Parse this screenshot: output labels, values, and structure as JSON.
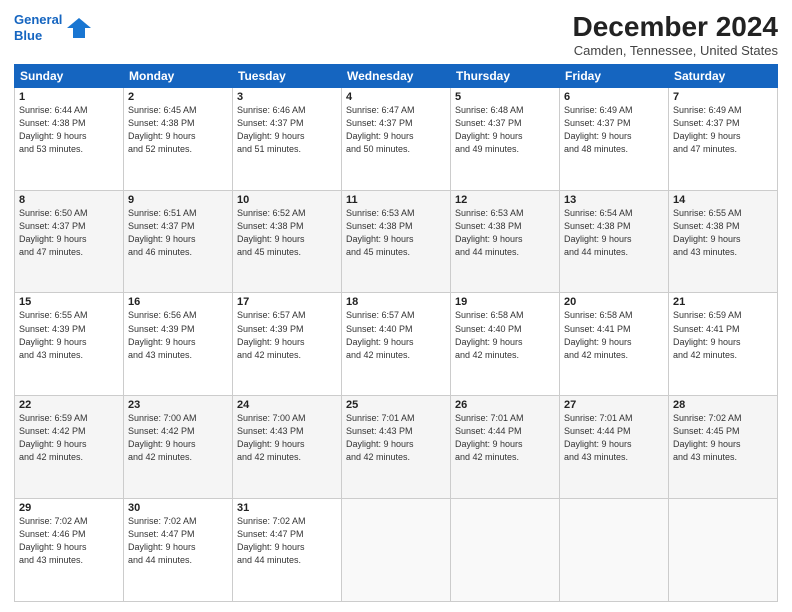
{
  "logo": {
    "line1": "General",
    "line2": "Blue",
    "arrow_color": "#1976d2"
  },
  "title": "December 2024",
  "subtitle": "Camden, Tennessee, United States",
  "days_of_week": [
    "Sunday",
    "Monday",
    "Tuesday",
    "Wednesday",
    "Thursday",
    "Friday",
    "Saturday"
  ],
  "weeks": [
    [
      {
        "day": "1",
        "info": "Sunrise: 6:44 AM\nSunset: 4:38 PM\nDaylight: 9 hours\nand 53 minutes."
      },
      {
        "day": "2",
        "info": "Sunrise: 6:45 AM\nSunset: 4:38 PM\nDaylight: 9 hours\nand 52 minutes."
      },
      {
        "day": "3",
        "info": "Sunrise: 6:46 AM\nSunset: 4:37 PM\nDaylight: 9 hours\nand 51 minutes."
      },
      {
        "day": "4",
        "info": "Sunrise: 6:47 AM\nSunset: 4:37 PM\nDaylight: 9 hours\nand 50 minutes."
      },
      {
        "day": "5",
        "info": "Sunrise: 6:48 AM\nSunset: 4:37 PM\nDaylight: 9 hours\nand 49 minutes."
      },
      {
        "day": "6",
        "info": "Sunrise: 6:49 AM\nSunset: 4:37 PM\nDaylight: 9 hours\nand 48 minutes."
      },
      {
        "day": "7",
        "info": "Sunrise: 6:49 AM\nSunset: 4:37 PM\nDaylight: 9 hours\nand 47 minutes."
      }
    ],
    [
      {
        "day": "8",
        "info": "Sunrise: 6:50 AM\nSunset: 4:37 PM\nDaylight: 9 hours\nand 47 minutes."
      },
      {
        "day": "9",
        "info": "Sunrise: 6:51 AM\nSunset: 4:37 PM\nDaylight: 9 hours\nand 46 minutes."
      },
      {
        "day": "10",
        "info": "Sunrise: 6:52 AM\nSunset: 4:38 PM\nDaylight: 9 hours\nand 45 minutes."
      },
      {
        "day": "11",
        "info": "Sunrise: 6:53 AM\nSunset: 4:38 PM\nDaylight: 9 hours\nand 45 minutes."
      },
      {
        "day": "12",
        "info": "Sunrise: 6:53 AM\nSunset: 4:38 PM\nDaylight: 9 hours\nand 44 minutes."
      },
      {
        "day": "13",
        "info": "Sunrise: 6:54 AM\nSunset: 4:38 PM\nDaylight: 9 hours\nand 44 minutes."
      },
      {
        "day": "14",
        "info": "Sunrise: 6:55 AM\nSunset: 4:38 PM\nDaylight: 9 hours\nand 43 minutes."
      }
    ],
    [
      {
        "day": "15",
        "info": "Sunrise: 6:55 AM\nSunset: 4:39 PM\nDaylight: 9 hours\nand 43 minutes."
      },
      {
        "day": "16",
        "info": "Sunrise: 6:56 AM\nSunset: 4:39 PM\nDaylight: 9 hours\nand 43 minutes."
      },
      {
        "day": "17",
        "info": "Sunrise: 6:57 AM\nSunset: 4:39 PM\nDaylight: 9 hours\nand 42 minutes."
      },
      {
        "day": "18",
        "info": "Sunrise: 6:57 AM\nSunset: 4:40 PM\nDaylight: 9 hours\nand 42 minutes."
      },
      {
        "day": "19",
        "info": "Sunrise: 6:58 AM\nSunset: 4:40 PM\nDaylight: 9 hours\nand 42 minutes."
      },
      {
        "day": "20",
        "info": "Sunrise: 6:58 AM\nSunset: 4:41 PM\nDaylight: 9 hours\nand 42 minutes."
      },
      {
        "day": "21",
        "info": "Sunrise: 6:59 AM\nSunset: 4:41 PM\nDaylight: 9 hours\nand 42 minutes."
      }
    ],
    [
      {
        "day": "22",
        "info": "Sunrise: 6:59 AM\nSunset: 4:42 PM\nDaylight: 9 hours\nand 42 minutes."
      },
      {
        "day": "23",
        "info": "Sunrise: 7:00 AM\nSunset: 4:42 PM\nDaylight: 9 hours\nand 42 minutes."
      },
      {
        "day": "24",
        "info": "Sunrise: 7:00 AM\nSunset: 4:43 PM\nDaylight: 9 hours\nand 42 minutes."
      },
      {
        "day": "25",
        "info": "Sunrise: 7:01 AM\nSunset: 4:43 PM\nDaylight: 9 hours\nand 42 minutes."
      },
      {
        "day": "26",
        "info": "Sunrise: 7:01 AM\nSunset: 4:44 PM\nDaylight: 9 hours\nand 42 minutes."
      },
      {
        "day": "27",
        "info": "Sunrise: 7:01 AM\nSunset: 4:44 PM\nDaylight: 9 hours\nand 43 minutes."
      },
      {
        "day": "28",
        "info": "Sunrise: 7:02 AM\nSunset: 4:45 PM\nDaylight: 9 hours\nand 43 minutes."
      }
    ],
    [
      {
        "day": "29",
        "info": "Sunrise: 7:02 AM\nSunset: 4:46 PM\nDaylight: 9 hours\nand 43 minutes."
      },
      {
        "day": "30",
        "info": "Sunrise: 7:02 AM\nSunset: 4:47 PM\nDaylight: 9 hours\nand 44 minutes."
      },
      {
        "day": "31",
        "info": "Sunrise: 7:02 AM\nSunset: 4:47 PM\nDaylight: 9 hours\nand 44 minutes."
      },
      null,
      null,
      null,
      null
    ]
  ]
}
